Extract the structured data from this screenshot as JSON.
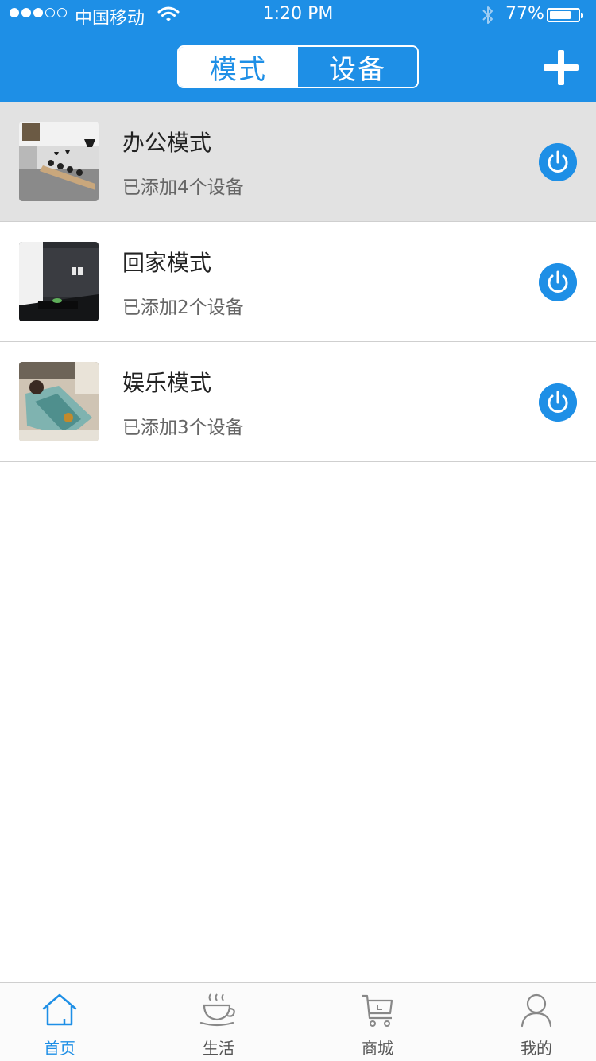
{
  "status_bar": {
    "carrier": "中国移动",
    "time": "1:20 PM",
    "battery_percent": "77%",
    "battery_level": 0.77,
    "signal_bars_filled": 3,
    "signal_bars_total": 5
  },
  "header": {
    "segments": [
      {
        "label": "模式",
        "active": true
      },
      {
        "label": "设备",
        "active": false
      }
    ],
    "add_icon": "plus-icon"
  },
  "modes": [
    {
      "title": "办公模式",
      "subtitle": "已添加4个设备",
      "highlighted": true,
      "icon": "power-icon"
    },
    {
      "title": "回家模式",
      "subtitle": "已添加2个设备",
      "highlighted": false,
      "icon": "power-icon"
    },
    {
      "title": "娱乐模式",
      "subtitle": "已添加3个设备",
      "highlighted": false,
      "icon": "power-icon"
    }
  ],
  "tabbar": {
    "items": [
      {
        "label": "首页",
        "icon": "home-icon",
        "active": true
      },
      {
        "label": "生活",
        "icon": "coffee-cup-icon",
        "active": false
      },
      {
        "label": "商城",
        "icon": "shopping-cart-icon",
        "active": false
      },
      {
        "label": "我的",
        "icon": "user-icon",
        "active": false
      }
    ]
  },
  "colors": {
    "accent": "#1e8fe6",
    "highlight_row": "#e2e2e2",
    "divider": "#cfcfcf"
  }
}
